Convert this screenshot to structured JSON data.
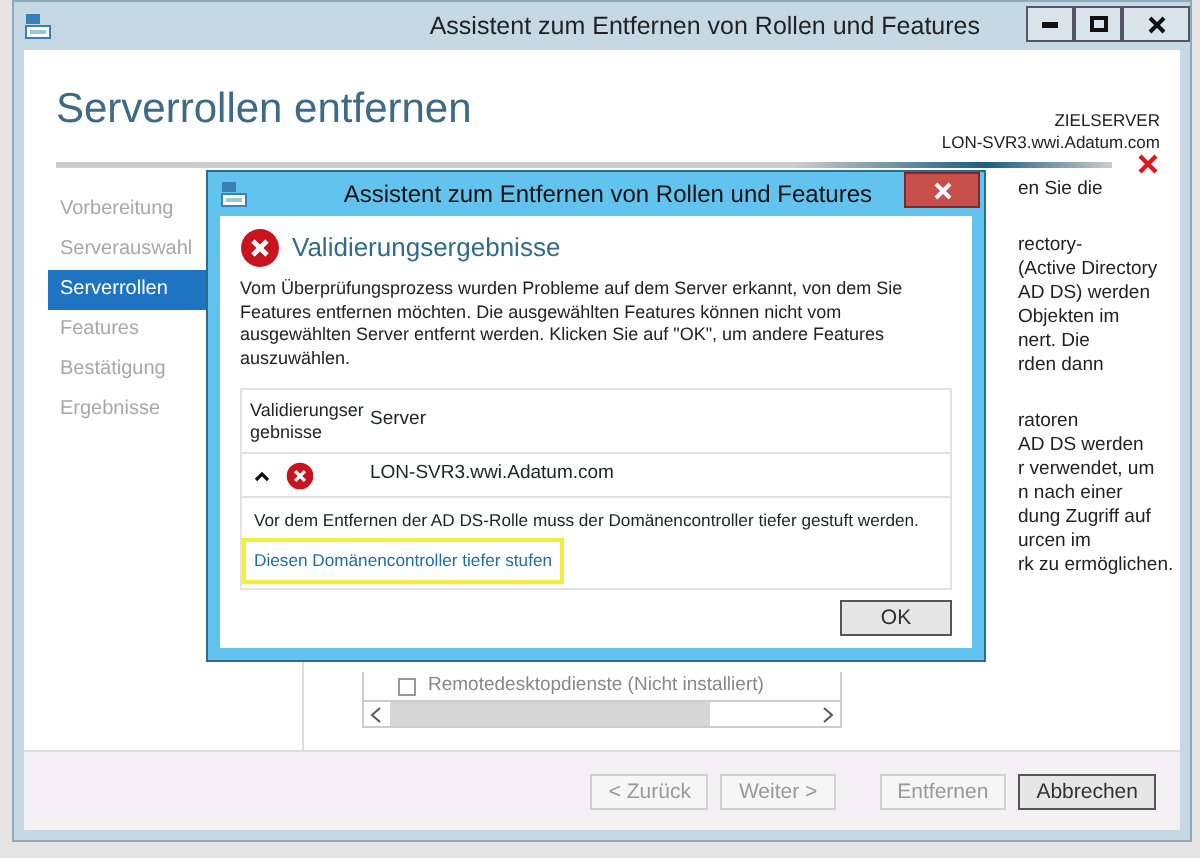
{
  "window": {
    "title": "Assistent zum Entfernen von Rollen und Features"
  },
  "page": {
    "title": "Serverrollen entfernen",
    "target_label": "ZIELSERVER",
    "target_server": "LON-SVR3.wwi.Adatum.com"
  },
  "steps": [
    {
      "label": "Vorbereitung",
      "selected": false
    },
    {
      "label": "Serverauswahl",
      "selected": false
    },
    {
      "label": "Serverrollen",
      "selected": true
    },
    {
      "label": "Features",
      "selected": false
    },
    {
      "label": "Bestätigung",
      "selected": false
    },
    {
      "label": "Ergebnisse",
      "selected": false
    }
  ],
  "description_paragraphs": [
    [
      "en Sie die"
    ],
    [
      "rectory-",
      "(Active Directory",
      "AD DS) werden",
      "Objekten im",
      "nert. Die",
      "rden dann"
    ],
    [
      "ratoren",
      "AD DS werden",
      "r verwendet, um",
      "n nach einer",
      "dung Zugriff auf",
      "urcen im",
      "rk zu ermöglichen."
    ]
  ],
  "roles_list": {
    "items": [
      {
        "label": "Remotedesktopdienste (Nicht installiert)",
        "checked": false
      }
    ]
  },
  "buttons": [
    {
      "label": "< Zurück",
      "disabled": true,
      "default": false
    },
    {
      "label": "Weiter >",
      "disabled": true,
      "default": false
    },
    {
      "label": "Entfernen",
      "disabled": true,
      "default": false
    },
    {
      "label": "Abbrechen",
      "disabled": false,
      "default": true
    }
  ],
  "dialog": {
    "title": "Assistent zum Entfernen von Rollen und Features",
    "heading": "Validierungsergebnisse",
    "message": "Vom Überprüfungsprozess wurden Probleme auf dem Server erkannt, von dem Sie Features entfernen möchten. Die ausgewählten Features können nicht vom ausgewählten Server entfernt werden. Klicken Sie auf \"OK\", um andere Features auszuwählen.",
    "table": {
      "columns": [
        "Validierungsergebnisse",
        "Server"
      ],
      "rows": [
        {
          "expanded": true,
          "server": "LON-SVR3.wwi.Adatum.com",
          "detail": "Vor dem Entfernen der AD DS-Rolle muss der Domänencontroller tiefer gestuft werden.",
          "link": "Diesen Domänencontroller tiefer stufen",
          "highlighted": true
        }
      ]
    },
    "ok_button": "OK"
  }
}
